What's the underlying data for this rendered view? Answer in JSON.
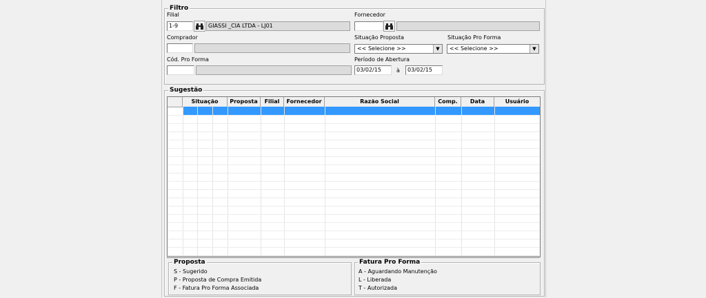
{
  "filtro": {
    "title": "Filtro",
    "filial": {
      "label": "Filial",
      "code": "1-9",
      "name": "GIASSI _CIA LTDA - LJ01"
    },
    "fornecedor": {
      "label": "Fornecedor",
      "code": "",
      "name": ""
    },
    "comprador": {
      "label": "Comprador",
      "code": "",
      "name": ""
    },
    "situacao_proposta": {
      "label": "Situação Proposta",
      "value": "<< Selecione >>"
    },
    "situacao_pro_forma": {
      "label": "Situação Pro Forma",
      "value": "<< Selecione >>"
    },
    "cod_pro_forma": {
      "label": "Cód. Pro Forma",
      "code": "",
      "name": ""
    },
    "periodo": {
      "label": "Período de Abertura",
      "from": "03/02/15",
      "sep": "à",
      "to": "03/02/15"
    }
  },
  "sugestao": {
    "title": "Sugestão",
    "columns": [
      "",
      "Situação",
      "",
      "Proposta",
      "Filial",
      "Fornecedor",
      "Razão Social",
      "Comp.",
      "Data",
      "Usuário"
    ],
    "rows": []
  },
  "legend": {
    "proposta": {
      "title": "Proposta",
      "items": [
        "S - Sugerido",
        "P - Proposta de Compra Emitida",
        "F - Fatura Pro Forma Associada"
      ]
    },
    "fatura": {
      "title": "Fatura Pro Forma",
      "items": [
        "A - Aguardando Manutenção",
        "L - Liberada",
        "T - Autorizada"
      ]
    }
  },
  "colors": {
    "selection": "#3399ff",
    "background": "#f0f0f0",
    "readonly": "#dcdcdc"
  },
  "icons": {
    "lookup": "binoculars-icon",
    "dropdown": "chevron-down-icon"
  }
}
